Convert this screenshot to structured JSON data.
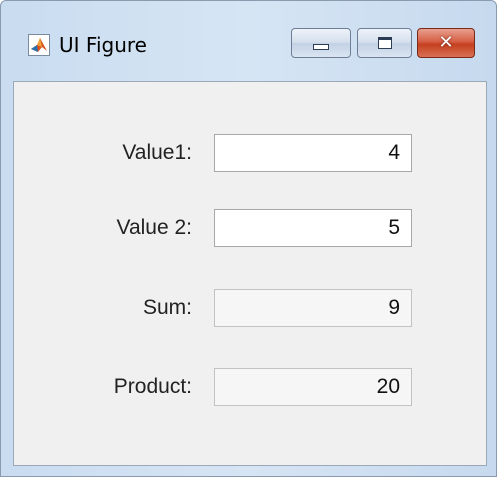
{
  "window": {
    "title": "UI Figure",
    "icon": "matlab-logo-icon",
    "controls": {
      "minimize": "minimize-icon",
      "maximize": "maximize-icon",
      "close": "close-icon",
      "close_glyph": "✕"
    }
  },
  "form": {
    "value1": {
      "label": "Value1:",
      "value": "4"
    },
    "value2": {
      "label": "Value 2:",
      "value": "5"
    },
    "sum": {
      "label": "Sum:",
      "value": "9"
    },
    "product": {
      "label": "Product:",
      "value": "20"
    }
  },
  "colors": {
    "close_button": "#c4401f",
    "client_background": "#f0f0f0",
    "frame": "#d6e5f4"
  }
}
